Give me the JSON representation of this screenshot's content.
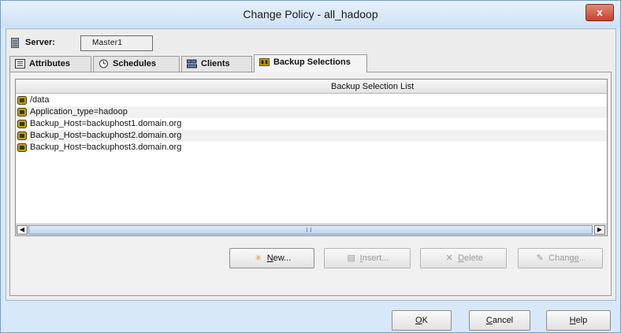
{
  "window": {
    "title": "Change Policy - all_hadoop",
    "close_label": "x"
  },
  "server": {
    "label": "Server:",
    "value": "Master1"
  },
  "tabs": [
    {
      "label": "Attributes",
      "icon": "attributes-icon"
    },
    {
      "label": "Schedules",
      "icon": "schedules-icon"
    },
    {
      "label": "Clients",
      "icon": "clients-icon"
    },
    {
      "label": "Backup Selections",
      "icon": "backup-selections-icon"
    }
  ],
  "list": {
    "header": "Backup Selection List",
    "items": [
      "/data",
      "Application_type=hadoop",
      "Backup_Host=backuphost1.domain.org",
      "Backup_Host=backuphost2.domain.org",
      "Backup_Host=backuphost3.domain.org"
    ]
  },
  "actions": {
    "new": {
      "prefix": "",
      "mnemonic": "N",
      "rest": "ew..."
    },
    "insert": {
      "prefix": "",
      "mnemonic": "I",
      "rest": "nsert..."
    },
    "delete": {
      "prefix": "",
      "mnemonic": "D",
      "rest": "elete"
    },
    "change": {
      "prefix": "Chang",
      "mnemonic": "e",
      "rest": "..."
    }
  },
  "footer": {
    "ok": {
      "mnemonic": "O",
      "rest": "K"
    },
    "cancel": {
      "mnemonic": "C",
      "rest": "ancel"
    },
    "help": {
      "mnemonic": "H",
      "rest": "elp"
    }
  },
  "colors": {
    "accent": "#7a9cc4",
    "selection_icon": "#c9a200"
  }
}
